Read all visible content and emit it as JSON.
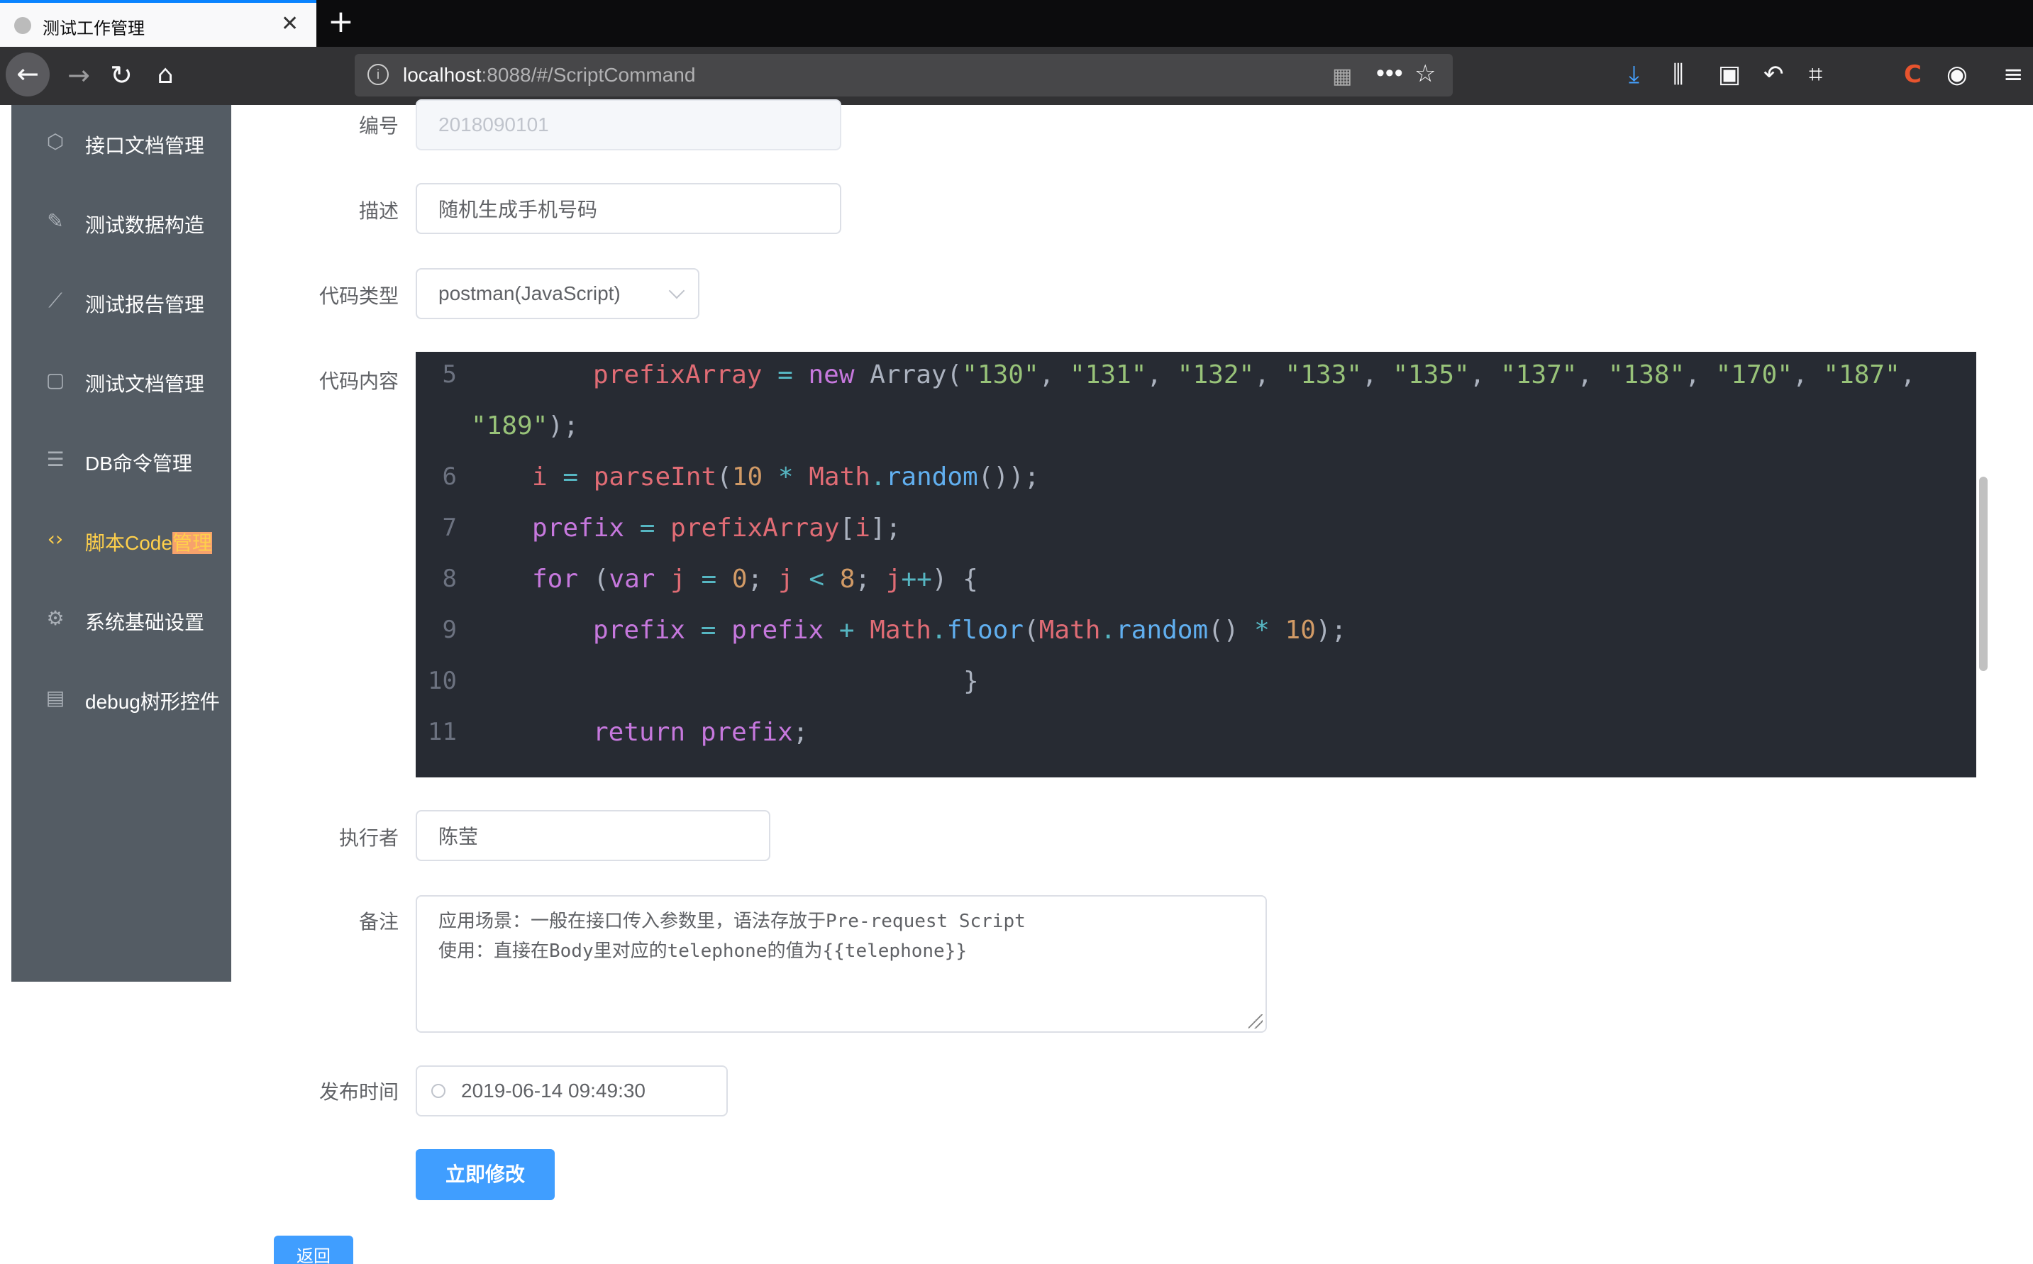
{
  "browser": {
    "tab_title": "测试工作管理",
    "tab_close": "✕",
    "new_tab": "+",
    "url_host": "localhost",
    "url_rest": ":8088/#/ScriptCommand"
  },
  "sidebar": {
    "items": [
      {
        "label": "接口文档管理",
        "icon": "upload-doc-icon"
      },
      {
        "label": "测试数据构造",
        "icon": "edit-doc-icon"
      },
      {
        "label": "测试报告管理",
        "icon": "chart-icon"
      },
      {
        "label": "测试文档管理",
        "icon": "word-doc-icon"
      },
      {
        "label": "DB命令管理",
        "icon": "database-icon"
      },
      {
        "label_a": "脚本Code",
        "label_b": "管理",
        "icon": "code-icon",
        "active": true
      },
      {
        "label": "系统基础设置",
        "icon": "gear-icon"
      },
      {
        "label": "debug树形控件",
        "icon": "document-icon"
      }
    ],
    "active_color": "#ffd04b"
  },
  "form": {
    "id": {
      "label": "编号",
      "value": "2018090101"
    },
    "desc": {
      "label": "描述",
      "value": "随机生成手机号码"
    },
    "code_type": {
      "label": "代码类型",
      "value": "postman(JavaScript)"
    },
    "code_content": {
      "label": "代码内容"
    },
    "executor": {
      "label": "执行者",
      "value": "陈莹"
    },
    "remark": {
      "label": "备注",
      "value": "应用场景：一般在接口传入参数里，语法存放于Pre-request Script\n使用：直接在Body里对应的telephone的值为{{telephone}}"
    },
    "publish_time": {
      "label": "发布时间",
      "value": "2019-06-14 09:49:30"
    },
    "submit_label": "立即修改",
    "back_label": "返回"
  },
  "code": {
    "line_numbers": [
      "5",
      "6",
      "7",
      "8",
      "9",
      "10",
      "11"
    ],
    "prefix_array_var": "prefixArray",
    "prefix_codes": [
      "130",
      "131",
      "132",
      "133",
      "135",
      "137",
      "138",
      "170",
      "187",
      "189"
    ]
  }
}
